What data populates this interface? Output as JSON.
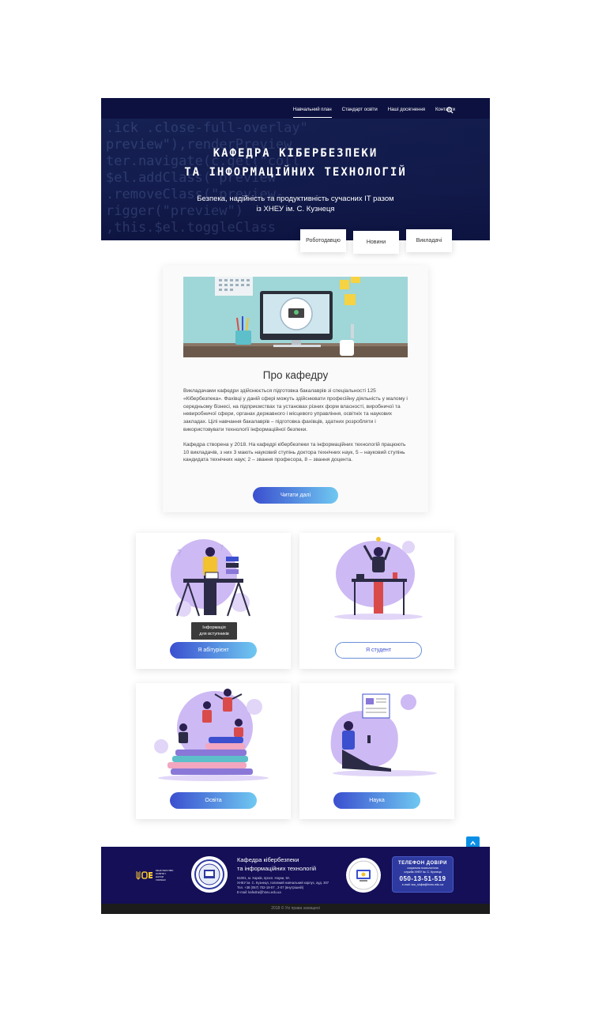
{
  "nav": {
    "items": [
      "Навчальний план",
      "Стандарт освіти",
      "Наші досягнення",
      "Контакти"
    ],
    "active_index": 0
  },
  "hero": {
    "code_lines": [
      ".ick .close-full-overlay\"",
      "preview\"),renderPreview",
      "ter.navigate(c.get(\"coll",
      "$el.addClass(\"preview",
      ".removeClass(\"preview-",
      "rigger(\"preview\")",
      ",this.$el.toggleClass"
    ],
    "title_line1": "КАФЕДРА КІБЕРБЕЗПЕКИ",
    "title_line2": "ТА ІНФОРМАЦІЙНИХ ТЕХНОЛОГІЙ",
    "subtitle_line1": "Безпека, надійність та продуктивність сучасних IT разом",
    "subtitle_line2": "із ХНЕУ ім. С. Кузнеця"
  },
  "tabs": [
    "Роботодавцю",
    "Новини",
    "Викладачі"
  ],
  "about": {
    "title": "Про кафедру",
    "p1": "Викладачами кафедри здійснюється підготовка бакалаврів зі спеціальності 125 «Кібербезпека». Фахівці у даній сфері можуть здійснювати професійну діяльність у малому і середньому бізнесі, на підприємствах та установах різних форм власності, виробничої та невиробничої сфери, органах державного і місцевого управління, освітніх та наукових закладах. Цілі навчання бакалаврів – підготовка фахівців, здатних розробляти і використовувати технології інформаційної безпеки.",
    "p2": "Кафедра створена у 2018. На кафедрі кібербезпеки та інформаційних технологій працюють 10 викладачів, з них 3 мають науковий ступінь доктора технічних наук, 5 – науковий ступінь кандидата технічних наук; 2 – звання професора, 8 – звання доцента.",
    "button": "Читати далі"
  },
  "cards": {
    "applicant_button": "Я абітурієнт",
    "applicant_tooltip_line1": "Інформація",
    "applicant_tooltip_line2": "для вступників",
    "student_button": "Я студент",
    "education_button": "Освіта",
    "science_button": "Наука"
  },
  "footer": {
    "logo_small_text": "МІНІСТЕРСТВО ОСВІТИ І НАУКИ УКРАЇНИ",
    "title_line1": "Кафедра кібербезпеки",
    "title_line2": "та інформаційних технологій",
    "addr1": "61001, м. Харків, просп. Науки, 9А",
    "addr2": "ХНЕУ ім. С. Кузнеця, головний навчальний корпус, ауд. 307",
    "addr3": "Тел. +38 (057) 702-18-07 , 2-07 (внутрішній)",
    "addr4": "E-mail: kafedra@hneu.edu.ua",
    "phone_title": "ТЕЛЕФОН ДОВІРИ",
    "phone_sub1": "соціальна психологічна",
    "phone_sub2": "служба ХНЕУ ім. С. Кузнеця",
    "phone_number": "050-13-51-519",
    "phone_email": "e-mail: soc_slujba@hneu.edu.ua",
    "copyright": "2018 © Усі права захищені"
  },
  "colors": {
    "hero_bg": "#0d1140",
    "footer_bg": "#140f57",
    "button_gradient_start": "#3b4fcf",
    "button_gradient_end": "#6fc8f1",
    "accent_purple": "#c9b8f0",
    "scroll_top": "#0b8fe6"
  }
}
